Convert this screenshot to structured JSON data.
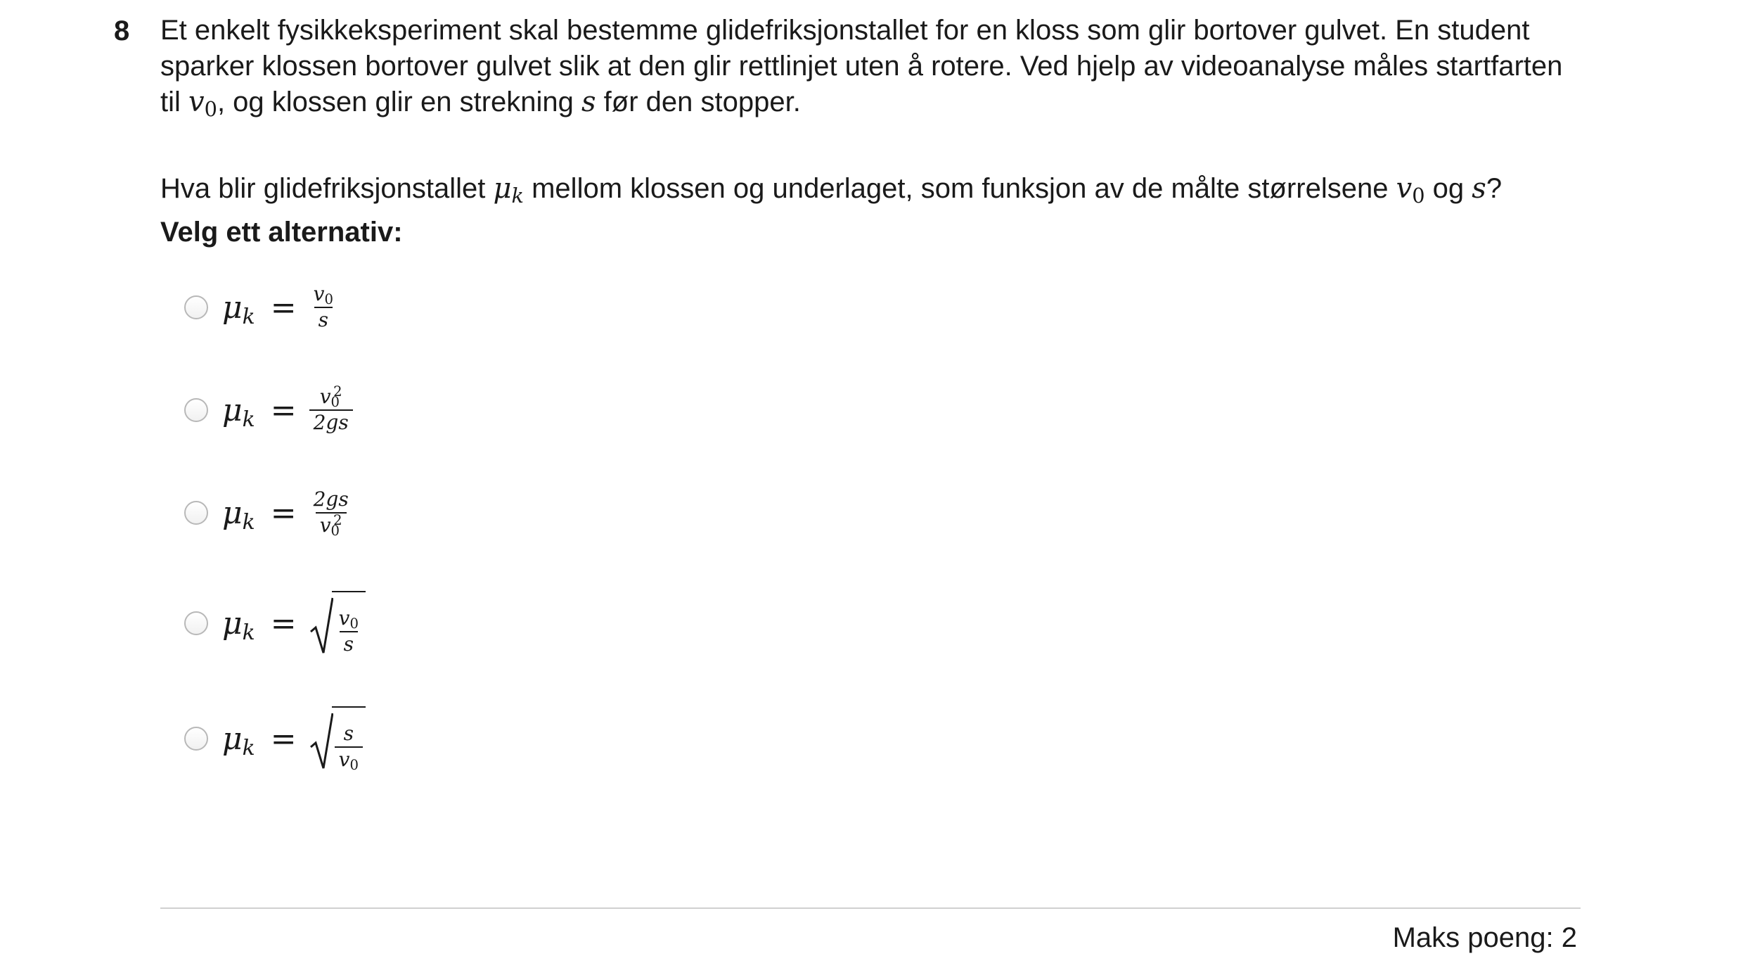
{
  "question": {
    "number": "8",
    "paragraph1": "Et enkelt fysikkeksperiment skal bestemme glidefriksjonstallet for en kloss som glir bortover gulvet. En student sparker klossen bortover gulvet slik at den glir rettlinjet uten å rotere. Ved hjelp av videoanalyse måles startfarten til",
    "paragraph1_mid": ", og klossen glir en strekning",
    "paragraph1_end": "før den stopper.",
    "paragraph2_start": "Hva blir glidefriksjonstallet",
    "paragraph2_mid": "mellom klossen og underlaget, som funksjon av de målte størrelsene",
    "paragraph2_og": "og",
    "paragraph2_end": "?",
    "instruction": "Velg ett alternativ:"
  },
  "symbols": {
    "v": "v",
    "zero": "0",
    "s": "s",
    "mu": "μ",
    "k": "k",
    "equals": "=",
    "two": "2",
    "two_gs": "2gs"
  },
  "max_points": "Maks poeng: 2"
}
